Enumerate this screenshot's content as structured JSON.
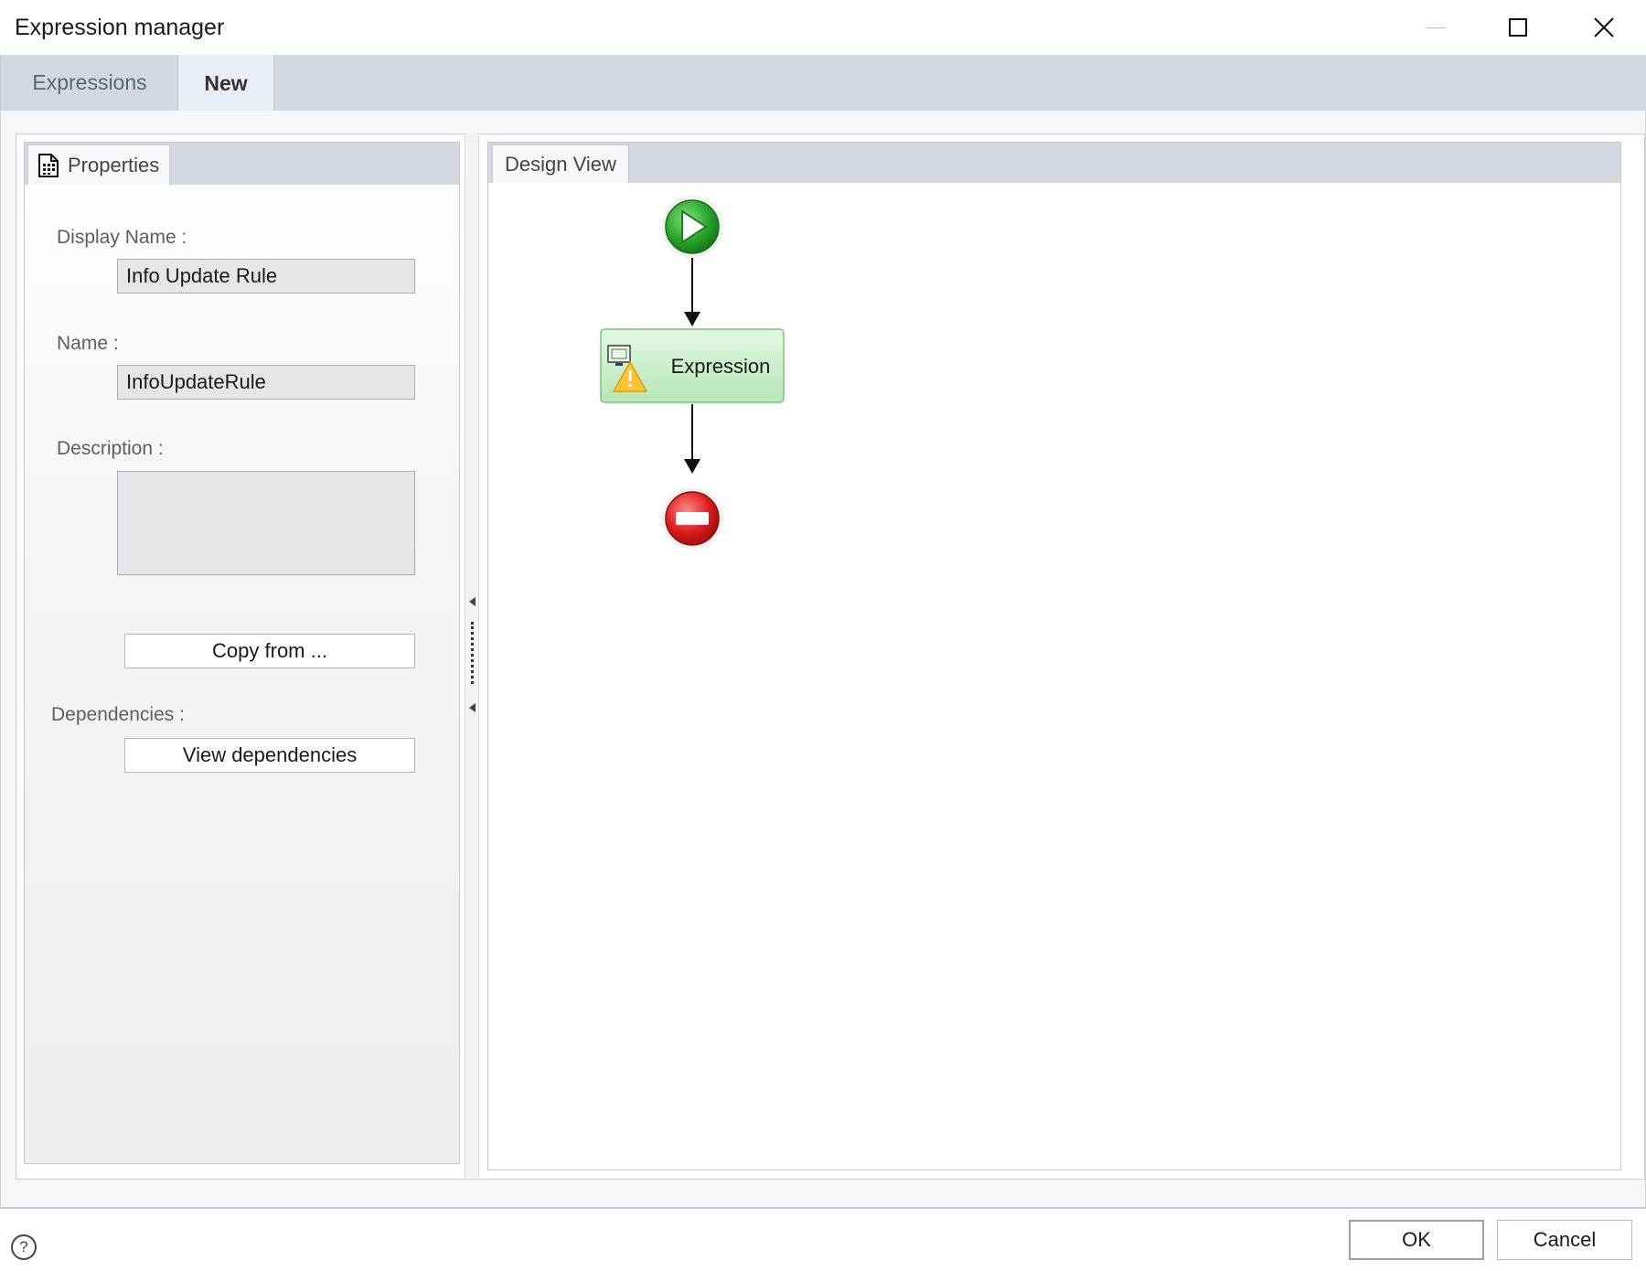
{
  "window": {
    "title": "Expression manager"
  },
  "tabs": [
    {
      "label": "Expressions",
      "active": false
    },
    {
      "label": "New",
      "active": true
    }
  ],
  "properties": {
    "tab_label": "Properties",
    "display_name_label": "Display Name :",
    "display_name_value": "Info Update Rule",
    "name_label": "Name :",
    "name_value": "InfoUpdateRule",
    "description_label": "Description :",
    "description_value": "",
    "copy_from_label": "Copy from ...",
    "dependencies_label": "Dependencies :",
    "view_dependencies_label": "View dependencies"
  },
  "design_view": {
    "tab_label": "Design View",
    "nodes": [
      {
        "kind": "start",
        "icon": "play-icon",
        "color": "#2aa52a"
      },
      {
        "kind": "activity",
        "label": "Expression",
        "icon": "expression-monitor-icon",
        "warning_icon": "warning-icon",
        "color": "#c8eec8"
      },
      {
        "kind": "end",
        "icon": "stop-icon",
        "color": "#dd1c1c"
      }
    ]
  },
  "footer": {
    "help_icon": "help-icon",
    "ok_label": "OK",
    "cancel_label": "Cancel"
  }
}
